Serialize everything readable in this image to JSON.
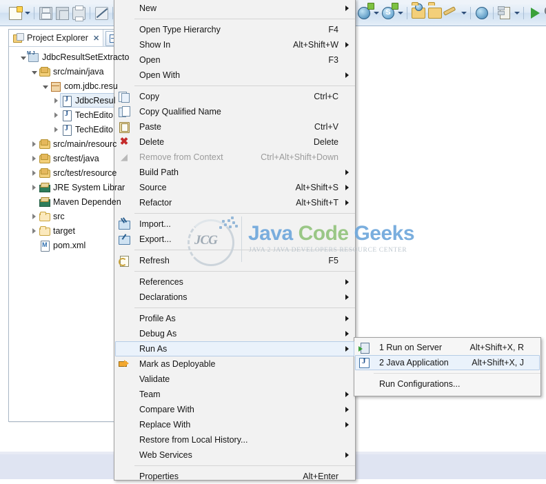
{
  "toolbar": {
    "groups": [
      {
        "items": [
          {
            "name": "new-wizard",
            "icon": "new-file-icon",
            "has_dropdown": true
          },
          {
            "name": "save",
            "icon": "save-icon",
            "has_dropdown": false
          },
          {
            "name": "save-all",
            "icon": "save-all-icon",
            "has_dropdown": false
          },
          {
            "name": "print",
            "icon": "print-icon",
            "has_dropdown": false
          },
          {
            "name": "toggle-mark-occurrences",
            "icon": "pencil-disabled-icon",
            "has_dropdown": false
          },
          {
            "name": "next-annotation",
            "icon": "annotation-lines-icon",
            "has_dropdown": false
          }
        ]
      },
      {
        "items": [
          {
            "name": "new-server",
            "icon": "globe-plus-icon",
            "has_dropdown": true
          },
          {
            "name": "new-search",
            "icon": "search-s-icon",
            "has_dropdown": true
          },
          {
            "name": "open-resource",
            "icon": "open-folder-globe-icon",
            "has_dropdown": false
          },
          {
            "name": "open-folder",
            "icon": "open-folder-icon",
            "has_dropdown": false
          },
          {
            "name": "quick-fix",
            "icon": "wrench-icon",
            "has_dropdown": true
          },
          {
            "name": "open-web-browser",
            "icon": "globe-icon",
            "has_dropdown": false
          },
          {
            "name": "database-connection",
            "icon": "database-icon",
            "has_dropdown": true
          },
          {
            "name": "run",
            "icon": "run-play-icon",
            "has_dropdown": false
          },
          {
            "name": "debug",
            "icon": "debug-bug-icon",
            "has_dropdown": false
          }
        ]
      }
    ]
  },
  "explorer": {
    "tab_label": "Project Explorer",
    "tab_close": "✕",
    "collapse_all_title": "Collapse All",
    "tree": [
      {
        "label": "JdbcResultSetExtracto",
        "icon": "maven-project-icon",
        "indent": 0,
        "twisty": "open",
        "selected": false
      },
      {
        "label": "src/main/java",
        "icon": "source-folder-icon",
        "indent": 1,
        "twisty": "open",
        "selected": false
      },
      {
        "label": "com.jdbc.resu",
        "icon": "package-icon",
        "indent": 2,
        "twisty": "open",
        "selected": false
      },
      {
        "label": "JdbcResul",
        "icon": "java-file-icon",
        "indent": 3,
        "twisty": "closed",
        "selected": true
      },
      {
        "label": "TechEdito",
        "icon": "java-file-icon",
        "indent": 3,
        "twisty": "closed",
        "selected": false
      },
      {
        "label": "TechEdito",
        "icon": "java-file-icon",
        "indent": 3,
        "twisty": "closed",
        "selected": false
      },
      {
        "label": "src/main/resourc",
        "icon": "source-folder-icon",
        "indent": 1,
        "twisty": "closed",
        "selected": false
      },
      {
        "label": "src/test/java",
        "icon": "source-folder-icon",
        "indent": 1,
        "twisty": "closed",
        "selected": false
      },
      {
        "label": "src/test/resource",
        "icon": "source-folder-icon",
        "indent": 1,
        "twisty": "closed",
        "selected": false
      },
      {
        "label": "JRE System Librar",
        "icon": "library-icon",
        "indent": 1,
        "twisty": "closed",
        "selected": false
      },
      {
        "label": "Maven Dependen",
        "icon": "library-icon",
        "indent": 1,
        "twisty": "none",
        "selected": false
      },
      {
        "label": "src",
        "icon": "folder-icon",
        "indent": 1,
        "twisty": "closed",
        "selected": false
      },
      {
        "label": "target",
        "icon": "folder-icon",
        "indent": 1,
        "twisty": "closed",
        "selected": false
      },
      {
        "label": "pom.xml",
        "icon": "xml-file-icon",
        "indent": 1,
        "twisty": "none",
        "selected": false
      }
    ]
  },
  "context_menu": {
    "items": [
      {
        "label": "New",
        "accel": "",
        "icon": "",
        "submenu": true,
        "disabled": false,
        "highlighted": false
      },
      {
        "separator": true
      },
      {
        "label": "Open Type Hierarchy",
        "accel": "F4",
        "icon": "",
        "submenu": false,
        "disabled": false,
        "highlighted": false
      },
      {
        "label": "Show In",
        "accel": "Alt+Shift+W",
        "icon": "",
        "submenu": true,
        "disabled": false,
        "highlighted": false
      },
      {
        "label": "Open",
        "accel": "F3",
        "icon": "",
        "submenu": false,
        "disabled": false,
        "highlighted": false
      },
      {
        "label": "Open With",
        "accel": "",
        "icon": "",
        "submenu": true,
        "disabled": false,
        "highlighted": false
      },
      {
        "separator": true
      },
      {
        "label": "Copy",
        "accel": "Ctrl+C",
        "icon": "copy-icon",
        "submenu": false,
        "disabled": false,
        "highlighted": false
      },
      {
        "label": "Copy Qualified Name",
        "accel": "",
        "icon": "copy-qualified-icon",
        "submenu": false,
        "disabled": false,
        "highlighted": false
      },
      {
        "label": "Paste",
        "accel": "Ctrl+V",
        "icon": "paste-icon",
        "submenu": false,
        "disabled": false,
        "highlighted": false
      },
      {
        "label": "Delete",
        "accel": "Delete",
        "icon": "delete-x-icon",
        "submenu": false,
        "disabled": false,
        "highlighted": false
      },
      {
        "label": "Remove from Context",
        "accel": "Ctrl+Alt+Shift+Down",
        "icon": "remove-context-icon",
        "submenu": false,
        "disabled": true,
        "highlighted": false
      },
      {
        "label": "Build Path",
        "accel": "",
        "icon": "",
        "submenu": true,
        "disabled": false,
        "highlighted": false
      },
      {
        "label": "Source",
        "accel": "Alt+Shift+S",
        "icon": "",
        "submenu": true,
        "disabled": false,
        "highlighted": false
      },
      {
        "label": "Refactor",
        "accel": "Alt+Shift+T",
        "icon": "",
        "submenu": true,
        "disabled": false,
        "highlighted": false
      },
      {
        "separator": true
      },
      {
        "label": "Import...",
        "accel": "",
        "icon": "import-icon",
        "submenu": false,
        "disabled": false,
        "highlighted": false
      },
      {
        "label": "Export...",
        "accel": "",
        "icon": "export-icon",
        "submenu": false,
        "disabled": false,
        "highlighted": false
      },
      {
        "separator": true
      },
      {
        "label": "Refresh",
        "accel": "F5",
        "icon": "refresh-icon",
        "submenu": false,
        "disabled": false,
        "highlighted": false
      },
      {
        "separator": true
      },
      {
        "label": "References",
        "accel": "",
        "icon": "",
        "submenu": true,
        "disabled": false,
        "highlighted": false
      },
      {
        "label": "Declarations",
        "accel": "",
        "icon": "",
        "submenu": true,
        "disabled": false,
        "highlighted": false
      },
      {
        "separator": true
      },
      {
        "label": "Profile As",
        "accel": "",
        "icon": "",
        "submenu": true,
        "disabled": false,
        "highlighted": false
      },
      {
        "label": "Debug As",
        "accel": "",
        "icon": "",
        "submenu": true,
        "disabled": false,
        "highlighted": false
      },
      {
        "label": "Run As",
        "accel": "",
        "icon": "",
        "submenu": true,
        "disabled": false,
        "highlighted": true
      },
      {
        "label": "Mark as Deployable",
        "accel": "",
        "icon": "mark-deployable-icon",
        "submenu": false,
        "disabled": false,
        "highlighted": false
      },
      {
        "label": "Validate",
        "accel": "",
        "icon": "",
        "submenu": false,
        "disabled": false,
        "highlighted": false
      },
      {
        "label": "Team",
        "accel": "",
        "icon": "",
        "submenu": true,
        "disabled": false,
        "highlighted": false
      },
      {
        "label": "Compare With",
        "accel": "",
        "icon": "",
        "submenu": true,
        "disabled": false,
        "highlighted": false
      },
      {
        "label": "Replace With",
        "accel": "",
        "icon": "",
        "submenu": true,
        "disabled": false,
        "highlighted": false
      },
      {
        "label": "Restore from Local History...",
        "accel": "",
        "icon": "",
        "submenu": false,
        "disabled": false,
        "highlighted": false
      },
      {
        "label": "Web Services",
        "accel": "",
        "icon": "",
        "submenu": true,
        "disabled": false,
        "highlighted": false
      },
      {
        "separator": true
      },
      {
        "label": "Properties",
        "accel": "Alt+Enter",
        "icon": "",
        "submenu": false,
        "disabled": false,
        "highlighted": false
      }
    ]
  },
  "run_as_submenu": {
    "items": [
      {
        "label": "1 Run on Server",
        "accel": "Alt+Shift+X, R",
        "icon": "run-on-server-icon",
        "submenu": false,
        "disabled": false,
        "highlighted": false
      },
      {
        "label": "2 Java Application",
        "accel": "Alt+Shift+X, J",
        "icon": "java-application-icon",
        "submenu": false,
        "disabled": false,
        "highlighted": true
      },
      {
        "separator": true
      },
      {
        "label": "Run Configurations...",
        "accel": "",
        "icon": "",
        "submenu": false,
        "disabled": false,
        "highlighted": false
      }
    ]
  },
  "watermark": {
    "logo_text": "JCG",
    "title_part1": "Java",
    "title_part2": "Code",
    "title_part3": "Geeks",
    "tagline": "JAVA 2 JAVA DEVELOPERS RESOURCE CENTER"
  },
  "colors": {
    "menu_bg": "#f2f2f2",
    "menu_border": "#a0a0a0",
    "highlight_bg": "#eaf2fb",
    "highlight_border": "#b5cce6",
    "disabled_text": "#9b9b9b",
    "toolbar_bg": "#dfeaf6",
    "selection_bg": "#e6eff8",
    "bottom_band": "#dfe4f2"
  }
}
